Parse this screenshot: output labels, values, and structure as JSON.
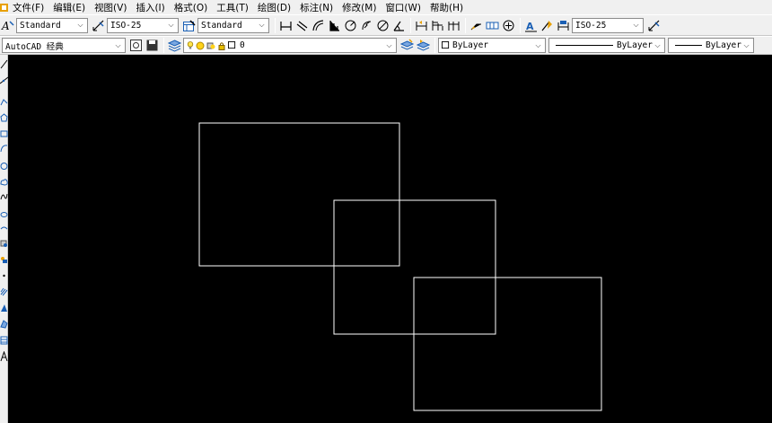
{
  "menu": [
    "文件(F)",
    "编辑(E)",
    "视图(V)",
    "插入(I)",
    "格式(O)",
    "工具(T)",
    "绘图(D)",
    "标注(N)",
    "修改(M)",
    "窗口(W)",
    "帮助(H)"
  ],
  "styles_toolbar": {
    "text_style": "Standard",
    "dim_style": "ISO-25",
    "table_style": "Standard",
    "dim_style_2": "ISO-25"
  },
  "workspace": "AutoCAD 经典",
  "layer": {
    "current": "0"
  },
  "properties": {
    "color": "ByLayer",
    "linetype": "ByLayer",
    "lineweight": "ByLayer"
  },
  "colors": {
    "canvas": "#000000",
    "toolbar": "#f0f0f0",
    "entity": "#ffffff"
  },
  "drawing": {
    "entities": [
      {
        "type": "rectangle",
        "name": "rectangle-1"
      },
      {
        "type": "rectangle",
        "name": "rectangle-2"
      },
      {
        "type": "rectangle",
        "name": "rectangle-3"
      }
    ]
  }
}
